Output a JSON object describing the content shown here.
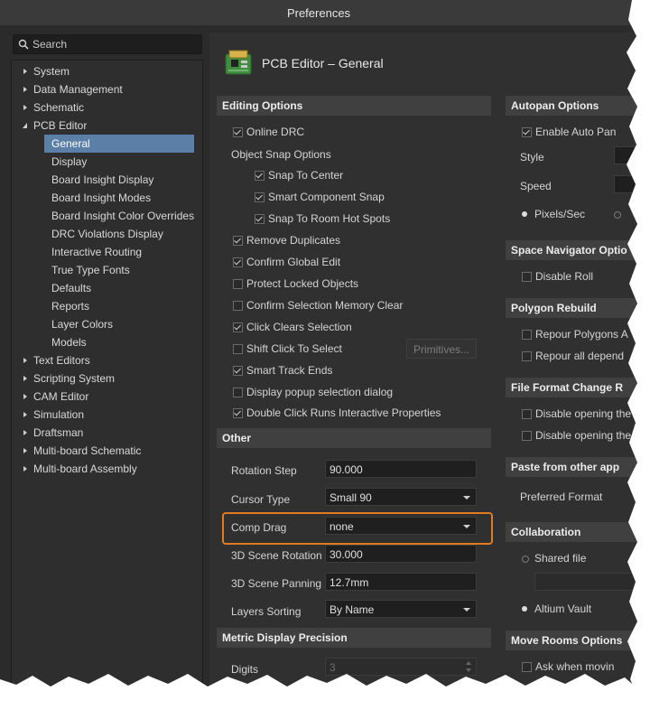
{
  "window": {
    "title": "Preferences"
  },
  "search": {
    "placeholder": "Search"
  },
  "tree": {
    "top": [
      {
        "label": "System",
        "expanded": false
      },
      {
        "label": "Data Management",
        "expanded": false
      },
      {
        "label": "Schematic",
        "expanded": false
      },
      {
        "label": "PCB Editor",
        "expanded": true
      }
    ],
    "pcb_children": [
      "General",
      "Display",
      "Board Insight Display",
      "Board Insight Modes",
      "Board Insight Color Overrides",
      "DRC Violations Display",
      "Interactive Routing",
      "True Type Fonts",
      "Defaults",
      "Reports",
      "Layer Colors",
      "Models"
    ],
    "bottom": [
      "Text Editors",
      "Scripting System",
      "CAM Editor",
      "Simulation",
      "Draftsman",
      "Multi-board Schematic",
      "Multi-board Assembly"
    ]
  },
  "page": {
    "title": "PCB Editor – General",
    "icon": "pcb-board-icon"
  },
  "editing": {
    "header": "Editing Options",
    "online_drc": "Online DRC",
    "object_snap": "Object Snap Options",
    "snap_center": "Snap To Center",
    "smart_comp_snap": "Smart Component Snap",
    "snap_room": "Snap To Room Hot Spots",
    "remove_dup": "Remove Duplicates",
    "confirm_global": "Confirm Global Edit",
    "protect_locked": "Protect Locked Objects",
    "confirm_sel_mem": "Confirm Selection Memory Clear",
    "click_clears": "Click Clears Selection",
    "shift_click": "Shift Click To Select",
    "primitives_btn": "Primitives...",
    "smart_track": "Smart Track Ends",
    "display_popup": "Display popup selection dialog",
    "double_click": "Double Click Runs Interactive Properties"
  },
  "other": {
    "header": "Other",
    "rotation_label": "Rotation Step",
    "rotation_value": "90.000",
    "cursor_label": "Cursor Type",
    "cursor_value": "Small 90",
    "comp_drag_label": "Comp Drag",
    "comp_drag_value": "none",
    "scene_rot_label": "3D Scene Rotation",
    "scene_rot_value": "30.000",
    "scene_pan_label": "3D Scene Panning",
    "scene_pan_value": "12.7mm",
    "layers_label": "Layers Sorting",
    "layers_value": "By Name"
  },
  "metric": {
    "header": "Metric Display Precision",
    "digits_label": "Digits",
    "digits_value": "3"
  },
  "autopan": {
    "header": "Autopan Options",
    "enable": "Enable Auto Pan",
    "style": "Style",
    "speed": "Speed",
    "pixels": "Pixels/Sec"
  },
  "space_nav": {
    "header": "Space Navigator Optio",
    "disable_roll": "Disable Roll"
  },
  "polygon": {
    "header": "Polygon Rebuild",
    "repour": "Repour Polygons A",
    "repour_all": "Repour all depend"
  },
  "file_format": {
    "header": "File Format Change R",
    "disable1": "Disable opening the",
    "disable2": "Disable opening the"
  },
  "paste": {
    "header": "Paste from other app",
    "preferred": "Preferred Format"
  },
  "collab": {
    "header": "Collaboration",
    "shared": "Shared file",
    "vault": "Altium Vault"
  },
  "move_rooms": {
    "header": "Move Rooms Options",
    "ask": "Ask when movin"
  },
  "colors": {
    "selection": "#5b7fa6",
    "highlight": "#e07b22",
    "panel": "#303030",
    "section": "#404040"
  }
}
